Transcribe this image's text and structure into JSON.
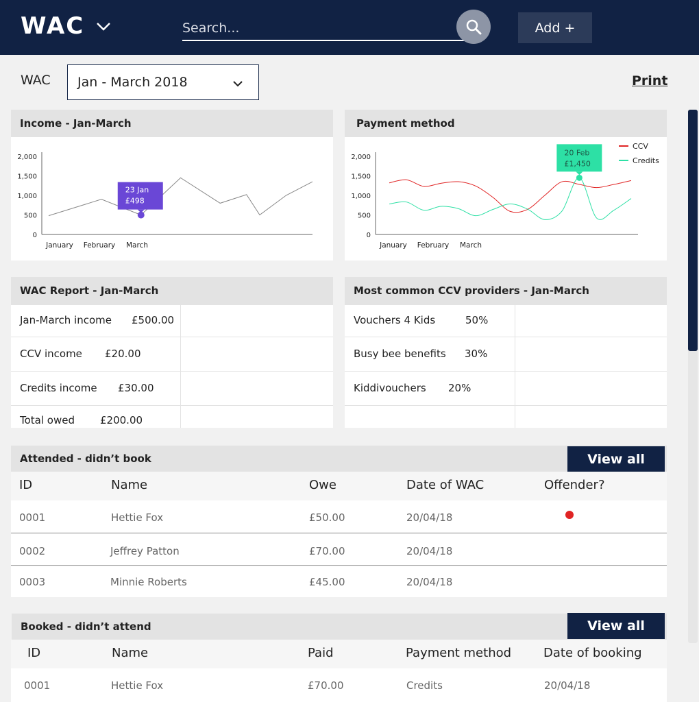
{
  "topbar": {
    "brand": "WAC",
    "search_placeholder": "Search...",
    "add_label": "Add +"
  },
  "filter": {
    "label": "WAC",
    "period": "Jan - March 2018",
    "print_label": "Print"
  },
  "income_card": {
    "title": "Income - Jan-March",
    "tooltip": {
      "date": "23 Jan",
      "value": "£498"
    }
  },
  "payment_card": {
    "title": "Payment method",
    "tooltip": {
      "date": "20 Feb",
      "value": "£1,450"
    }
  },
  "chart_data": [
    {
      "type": "line",
      "title": "Income - Jan-March",
      "categories": [
        "January",
        "February",
        "March"
      ],
      "yticks": [
        "0",
        "500",
        "1,000",
        "1,500",
        "2,000"
      ],
      "ylim": [
        0,
        2000
      ],
      "x": [
        0.0,
        0.2,
        0.35,
        0.5,
        0.65,
        0.75,
        0.8,
        0.9,
        1.0
      ],
      "series": [
        {
          "values": [
            480,
            900,
            498,
            1450,
            800,
            1020,
            500,
            1000,
            1350
          ],
          "color": "#888888"
        }
      ],
      "highlight": {
        "x_index": 2,
        "color": "#6a47d6"
      },
      "grid": false
    },
    {
      "type": "line",
      "title": "Payment method",
      "categories": [
        "January",
        "February",
        "March"
      ],
      "yticks": [
        "0",
        "500",
        "1,000",
        "1,500",
        "2,000"
      ],
      "ylim": [
        0,
        2000
      ],
      "series": [
        {
          "name": "CCV",
          "color": "#e02424",
          "values": [
            1320,
            1400,
            1230,
            1310,
            1350,
            1240,
            950,
            590,
            640,
            1000,
            1350,
            1280,
            1200,
            1280,
            1380
          ]
        },
        {
          "name": "Credits",
          "color": "#2de0a5",
          "values": [
            780,
            830,
            620,
            720,
            660,
            480,
            640,
            780,
            650,
            380,
            600,
            1450,
            420,
            620,
            920
          ]
        }
      ],
      "highlight": {
        "series": "Credits",
        "x_index": 11,
        "color": "#2de0a5"
      },
      "legend": "top-right",
      "grid": false
    }
  ],
  "report_card": {
    "title": "WAC Report - Jan-March",
    "rows": [
      {
        "label": "Jan-March income",
        "value": "£500.00"
      },
      {
        "label": "CCV income",
        "value": "£20.00"
      },
      {
        "label": "Credits income",
        "value": "£30.00"
      },
      {
        "label": "Total owed",
        "value": "£200.00"
      }
    ]
  },
  "providers_card": {
    "title": "Most common CCV providers - Jan-March",
    "rows": [
      {
        "label": "Vouchers 4 Kids",
        "value": "50%"
      },
      {
        "label": "Busy bee benefits",
        "value": "30%"
      },
      {
        "label": "Kiddivouchers",
        "value": "20%"
      }
    ]
  },
  "attended": {
    "title": "Attended - didn’t book",
    "view_all": "View all",
    "columns": [
      "ID",
      "Name",
      "Owe",
      "Date of WAC",
      "Offender?"
    ],
    "rows": [
      {
        "id": "0001",
        "name": "Hettie Fox",
        "owe": "£50.00",
        "date": "20/04/18",
        "offender": true
      },
      {
        "id": "0002",
        "name": "Jeffrey Patton",
        "owe": "£70.00",
        "date": "20/04/18",
        "offender": false
      },
      {
        "id": "0003",
        "name": "Minnie Roberts",
        "owe": "£45.00",
        "date": "20/04/18",
        "offender": false
      }
    ],
    "offender_color": "#e02424"
  },
  "booked": {
    "title": "Booked - didn’t attend",
    "view_all": "View all",
    "columns": [
      "ID",
      "Name",
      "Paid",
      "Payment method",
      "Date of booking"
    ],
    "rows": [
      {
        "id": "0001",
        "name": "Hettie Fox",
        "paid": "£70.00",
        "method": "Credits",
        "date": "20/04/18"
      }
    ]
  },
  "colors": {
    "navy": "#112244",
    "panel": "#e3e3e3",
    "accent_purple": "#6a47d6",
    "accent_green": "#2de0a5",
    "ccv_red": "#e02424"
  }
}
